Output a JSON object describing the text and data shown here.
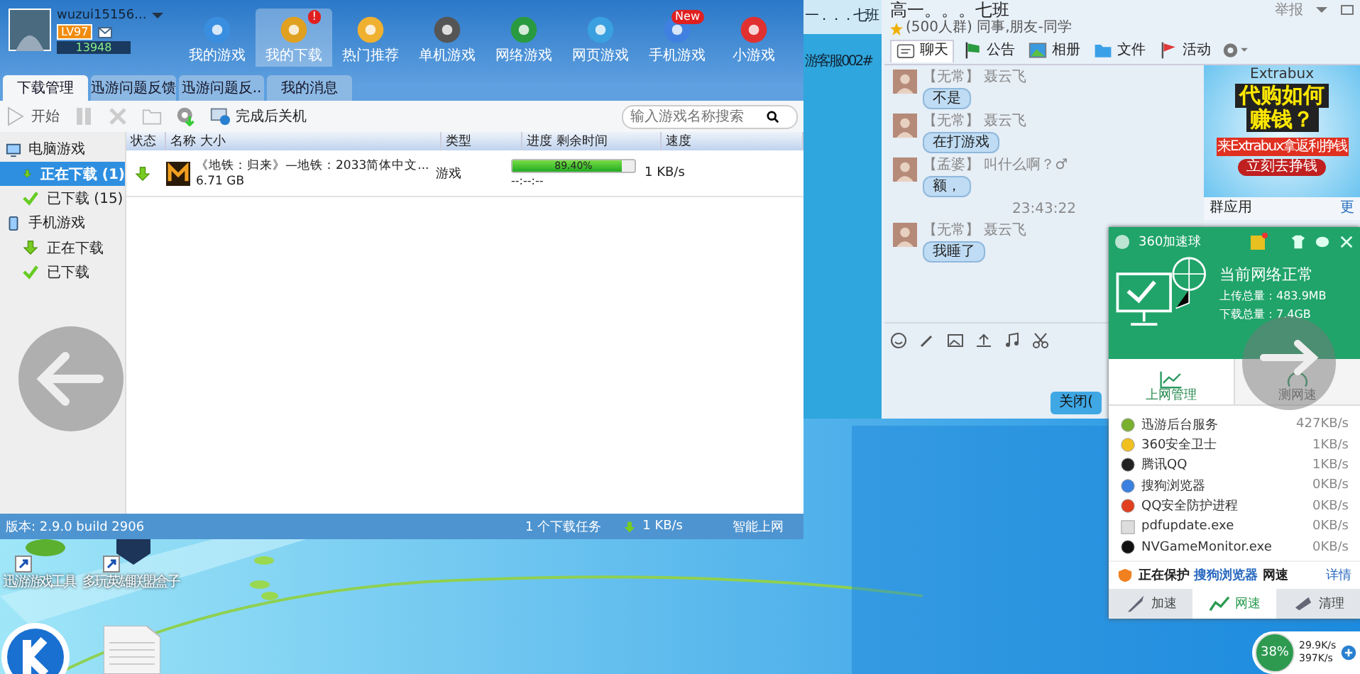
{
  "game_window": {
    "user": {
      "name": "wuzui15156...",
      "level": "LV97",
      "points": "13948"
    },
    "nav": [
      {
        "label": "我的游戏",
        "selected": false
      },
      {
        "label": "我的下载",
        "selected": true,
        "badge": "!"
      },
      {
        "label": "热门推荐",
        "selected": false
      },
      {
        "label": "单机游戏",
        "selected": false
      },
      {
        "label": "网络游戏",
        "selected": false
      },
      {
        "label": "网页游戏",
        "selected": false
      },
      {
        "label": "手机游戏",
        "selected": false,
        "badge": "New"
      },
      {
        "label": "小游戏",
        "selected": false
      }
    ],
    "tabs": [
      {
        "label": "下载管理",
        "selected": true
      },
      {
        "label": "迅游问题反馈",
        "selected": false
      },
      {
        "label": "迅游问题反..",
        "selected": false
      },
      {
        "label": "我的消息",
        "selected": false
      }
    ],
    "toolbar": {
      "start_label": "开始",
      "shutdown_label": "完成后关机",
      "search": {
        "placeholder": "输入游戏名称搜索"
      }
    },
    "sidebar": [
      {
        "label": "电脑游戏",
        "children": [
          {
            "label": "正在下载 (1)",
            "selected": true
          },
          {
            "label": "已下载 (15)",
            "selected": false
          }
        ]
      },
      {
        "label": "手机游戏",
        "children": [
          {
            "label": "正在下载",
            "selected": false
          },
          {
            "label": "已下载",
            "selected": false
          }
        ]
      }
    ],
    "table": {
      "columns": [
        "状态",
        "名称 大小",
        "类型",
        "进度 剩余时间",
        "速度"
      ],
      "rows": [
        {
          "name": "《地铁：归来》—地铁：2033简体中文...",
          "size": "6.71 GB",
          "type": "游戏",
          "level": 0.894,
          "percent": "89.40%",
          "remaining": "--:--:--",
          "speed": "1 KB/s"
        }
      ]
    },
    "status_bar": {
      "version": "版本: 2.9.0 build 2906",
      "tasks": "1 个下载任务",
      "speed": "1 KB/s",
      "mode": "智能上网"
    }
  },
  "qq_window": {
    "side_items": [
      "一．．．七班",
      "游客服002#"
    ],
    "title": "高一。。。七班",
    "subtitle": "(500人群) 同事,朋友-同学",
    "report": "举报",
    "tabs": [
      {
        "label": "聊天",
        "selected": true
      },
      {
        "label": "公告",
        "selected": false
      },
      {
        "label": "相册",
        "selected": false
      },
      {
        "label": "文件",
        "selected": false
      },
      {
        "label": "活动",
        "selected": false
      }
    ],
    "messages": [
      {
        "tag": "【无常】",
        "name": "聂云飞",
        "text": "不是"
      },
      {
        "tag": "【无常】",
        "name": "聂云飞",
        "text": "在打游戏"
      },
      {
        "tag": "【孟婆】",
        "name": "叫什么啊？♂",
        "text": "额，"
      },
      {
        "time": "23:43:22"
      },
      {
        "tag": "【无常】",
        "name": "聂云飞",
        "text": "我睡了"
      }
    ],
    "ad": {
      "brand": "Extrabux",
      "headline_1": "代购如何",
      "headline_2": "赚钱？",
      "tagline": "来Extrabux拿返利挣钱",
      "cta": "立刻去挣钱"
    },
    "apps_title": "群应用",
    "apps_more": "更",
    "close_button": "关闭("
  },
  "speed_ball": {
    "title": "360加速球",
    "status": "当前网络正常",
    "upload": "上传总量：483.9MB",
    "download": "下载总量：7.4GB",
    "tabs": [
      {
        "label": "上网管理",
        "selected": true
      },
      {
        "label": "测网速",
        "selected": false
      }
    ],
    "apps": [
      {
        "name": "迅游后台服务",
        "speed": "427KB/s"
      },
      {
        "name": "360安全卫士",
        "speed": "1KB/s"
      },
      {
        "name": "腾讯QQ",
        "speed": "1KB/s"
      },
      {
        "name": "搜狗浏览器",
        "speed": "0KB/s"
      },
      {
        "name": "QQ安全防护进程",
        "speed": "0KB/s"
      },
      {
        "name": "pdfupdate.exe",
        "speed": "0KB/s"
      },
      {
        "name": "NVGameMonitor.exe",
        "speed": "0KB/s"
      }
    ],
    "protect": {
      "prefix": "正在保护",
      "app": "搜狗浏览器",
      "suffix": "网速",
      "details": "详情"
    },
    "bottom_tabs": [
      {
        "label": "加速",
        "selected": false
      },
      {
        "label": "网速",
        "selected": true
      },
      {
        "label": "清理",
        "selected": false
      }
    ]
  },
  "desktop": {
    "icons": [
      "迅游游戏工具",
      "多玩英雄联盟盒子"
    ]
  },
  "tray_ball": {
    "percent": "38%",
    "up": "29.9K/s",
    "down": "397K/s"
  }
}
